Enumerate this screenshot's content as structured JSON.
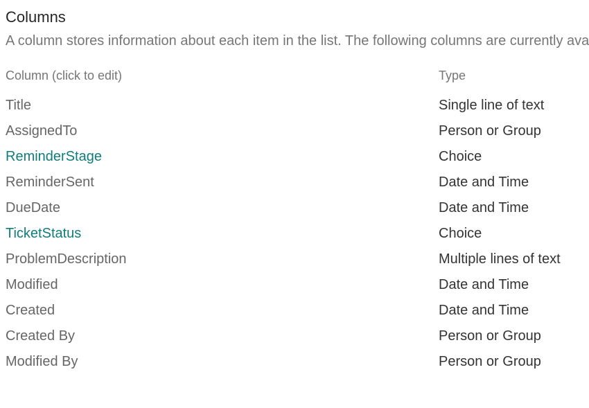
{
  "section": {
    "title": "Columns",
    "description": "A column stores information about each item in the list. The following columns are currently ava"
  },
  "table": {
    "headers": {
      "name": "Column (click to edit)",
      "type": "Type"
    },
    "rows": [
      {
        "name": "Title",
        "type": "Single line of text",
        "link": false
      },
      {
        "name": "AssignedTo",
        "type": "Person or Group",
        "link": false
      },
      {
        "name": "ReminderStage",
        "type": "Choice",
        "link": true
      },
      {
        "name": "ReminderSent",
        "type": "Date and Time",
        "link": false
      },
      {
        "name": "DueDate",
        "type": "Date and Time",
        "link": false
      },
      {
        "name": "TicketStatus",
        "type": "Choice",
        "link": true
      },
      {
        "name": "ProblemDescription",
        "type": "Multiple lines of text",
        "link": false
      },
      {
        "name": "Modified",
        "type": "Date and Time",
        "link": false
      },
      {
        "name": "Created",
        "type": "Date and Time",
        "link": false
      },
      {
        "name": "Created By",
        "type": "Person or Group",
        "link": false
      },
      {
        "name": "Modified By",
        "type": "Person or Group",
        "link": false
      }
    ]
  }
}
